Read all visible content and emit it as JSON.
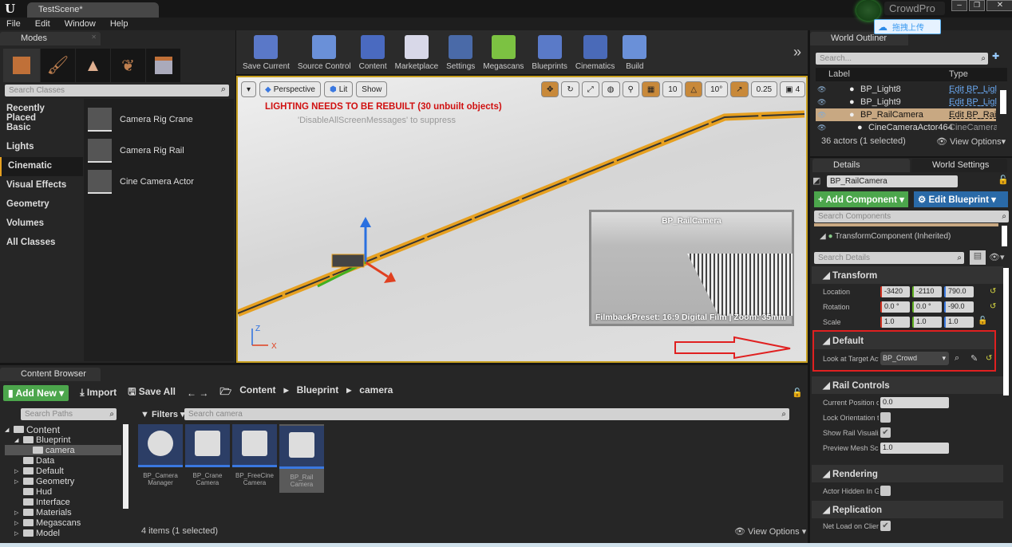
{
  "window": {
    "tab": "TestScene*",
    "app_badge": "CrowdPro",
    "upload_label": "拖拽上传",
    "controls": [
      "minimize",
      "maximize",
      "close"
    ]
  },
  "menu": [
    "File",
    "Edit",
    "Window",
    "Help"
  ],
  "modes": {
    "tab": "Modes",
    "search_placeholder": "Search Classes",
    "categories": [
      "Recently Placed",
      "Basic",
      "Lights",
      "Cinematic",
      "Visual Effects",
      "Geometry",
      "Volumes",
      "All Classes"
    ],
    "selected": "Cinematic",
    "items": [
      "Camera Rig Crane",
      "Camera Rig Rail",
      "Cine Camera Actor"
    ]
  },
  "toolbar": [
    {
      "label": "Save Current",
      "icon": "save-icon",
      "color": "#5a78c8"
    },
    {
      "label": "Source Control",
      "icon": "source-control-icon",
      "color": "#6a90d8"
    },
    {
      "label": "Content",
      "icon": "content-icon",
      "color": "#4a6ac0"
    },
    {
      "label": "Marketplace",
      "icon": "marketplace-icon",
      "color": "#d8d8e8"
    },
    {
      "label": "Settings",
      "icon": "settings-icon",
      "color": "#4a6aa8"
    },
    {
      "label": "Megascans",
      "icon": "megascans-icon",
      "color": "#7cc242"
    },
    {
      "label": "Blueprints",
      "icon": "blueprints-icon",
      "color": "#5a7ac8"
    },
    {
      "label": "Cinematics",
      "icon": "cinematics-icon",
      "color": "#4a6ab8"
    },
    {
      "label": "Build",
      "icon": "build-icon",
      "color": "#6a90d8"
    }
  ],
  "viewport": {
    "perspective": "Perspective",
    "lit": "Lit",
    "show": "Show",
    "grid_snap": "10",
    "rot_snap": "10°",
    "scale_snap": "0.25",
    "cam_speed": "4",
    "warning": "LIGHTING NEEDS TO BE REBUILT (30 unbuilt objects)",
    "suppress": "'DisableAllScreenMessages' to suppress",
    "preview_title": "BP_RailCamera",
    "preview_info": "FilmbackPreset: 16:9 Digital Film | Zoom: 35mm",
    "axis_z": "Z",
    "axis_x": "X",
    "rail_color": "#e6a020",
    "arrow_color": "#e02020"
  },
  "content_browser": {
    "tab": "Content Browser",
    "add_new": "Add New",
    "import": "Import",
    "save_all": "Save All",
    "breadcrumb": [
      "Content",
      "Blueprint",
      "camera"
    ],
    "search_paths": "Search Paths",
    "filters": "Filters",
    "search_placeholder": "Search camera",
    "tree": [
      {
        "name": "Content",
        "level": 0,
        "exp": "open"
      },
      {
        "name": "Blueprint",
        "level": 1,
        "exp": "open"
      },
      {
        "name": "camera",
        "level": 2,
        "exp": "",
        "sel": true
      },
      {
        "name": "Data",
        "level": 1,
        "exp": ""
      },
      {
        "name": "Default",
        "level": 1,
        "exp": "closed"
      },
      {
        "name": "Geometry",
        "level": 1,
        "exp": "closed"
      },
      {
        "name": "Hud",
        "level": 1,
        "exp": ""
      },
      {
        "name": "Interface",
        "level": 1,
        "exp": ""
      },
      {
        "name": "Materials",
        "level": 1,
        "exp": "closed"
      },
      {
        "name": "Megascans",
        "level": 1,
        "exp": "closed"
      },
      {
        "name": "Model",
        "level": 1,
        "exp": "closed"
      }
    ],
    "assets": [
      {
        "l1": "BP_Camera",
        "l2": "Manager"
      },
      {
        "l1": "BP_Crane",
        "l2": "Camera"
      },
      {
        "l1": "BP_FreeCine",
        "l2": "Camera"
      },
      {
        "l1": "BP_Rail",
        "l2": "Camera",
        "sel": true
      }
    ],
    "status": "4 items (1 selected)",
    "view_options": "View Options"
  },
  "outliner": {
    "tab": "World Outliner",
    "search_placeholder": "Search...",
    "col_label": "Label",
    "col_type": "Type",
    "rows": [
      {
        "label": "BP_Light8",
        "type": "Edit BP_Ligl"
      },
      {
        "label": "BP_Light9",
        "type": "Edit BP_Ligl"
      },
      {
        "label": "BP_RailCamera",
        "type": "Edit BP_Rai",
        "sel": true
      },
      {
        "label": "CineCameraActor464",
        "type": "CineCameraA"
      }
    ],
    "status": "36 actors (1 selected)",
    "view_options": "View Options"
  },
  "details": {
    "tab": "Details",
    "tab2": "World Settings",
    "name": "BP_RailCamera",
    "add_component": "Add Component",
    "edit_blueprint": "Edit Blueprint",
    "search_components": "Search Components",
    "component": "TransformComponent (Inherited)",
    "search_details": "Search Details",
    "transform": {
      "title": "Transform",
      "location_label": "Location",
      "rotation_label": "Rotation",
      "scale_label": "Scale",
      "location": [
        "-3420",
        "-2110",
        "790.0"
      ],
      "rotation": [
        "0.0 °",
        "0.0 °",
        "-90.0"
      ],
      "scale": [
        "1.0",
        "1.0",
        "1.0"
      ]
    },
    "default": {
      "title": "Default",
      "look_label": "Look at Target Act",
      "look_value": "BP_Crowd"
    },
    "rail": {
      "title": "Rail Controls",
      "pos_label": "Current Position or",
      "pos_value": "0.0",
      "lock_label": "Lock Orientation to",
      "lock": false,
      "show_label": "Show Rail Visualiz",
      "show": true,
      "mesh_label": "Preview Mesh Sca",
      "mesh_value": "1.0"
    },
    "rendering": {
      "title": "Rendering",
      "hidden_label": "Actor Hidden In Ga",
      "hidden": false
    },
    "replication": {
      "title": "Replication",
      "net_label": "Net Load on Client",
      "net": true
    }
  },
  "highlight_color": "#e02020"
}
